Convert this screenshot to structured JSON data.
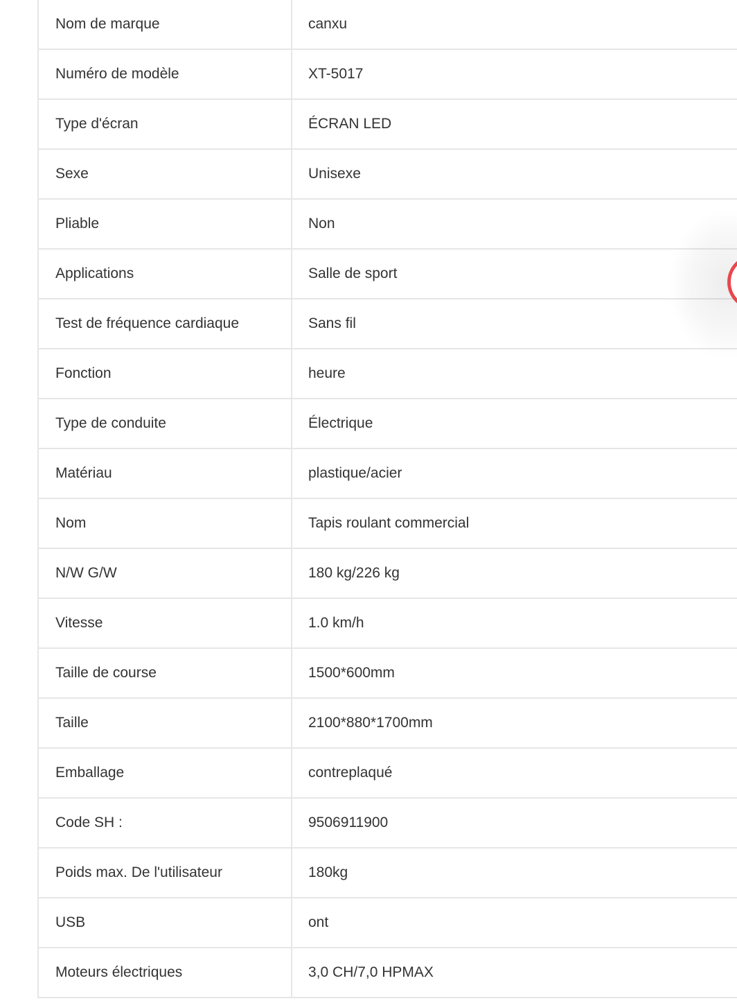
{
  "specs": {
    "rows": [
      {
        "label": "Nom de marque",
        "value": "canxu"
      },
      {
        "label": "Numéro de modèle",
        "value": "XT-5017"
      },
      {
        "label": "Type d'écran",
        "value": "ÉCRAN LED"
      },
      {
        "label": "Sexe",
        "value": "Unisexe"
      },
      {
        "label": "Pliable",
        "value": "Non"
      },
      {
        "label": "Applications",
        "value": "Salle de sport"
      },
      {
        "label": "Test de fréquence cardiaque",
        "value": "Sans fil"
      },
      {
        "label": "Fonction",
        "value": "heure"
      },
      {
        "label": "Type de conduite",
        "value": "Électrique"
      },
      {
        "label": "Matériau",
        "value": "plastique/acier"
      },
      {
        "label": "Nom",
        "value": "Tapis roulant commercial"
      },
      {
        "label": "N/W G/W",
        "value": "180 kg/226 kg"
      },
      {
        "label": "Vitesse",
        "value": "1.0 km/h"
      },
      {
        "label": "Taille de course",
        "value": "1500*600mm"
      },
      {
        "label": "Taille",
        "value": "2100*880*1700mm"
      },
      {
        "label": "Emballage",
        "value": "contreplaqué"
      },
      {
        "label": "Code SH :",
        "value": "9506911900"
      },
      {
        "label": "Poids max. De l'utilisateur",
        "value": "180kg"
      },
      {
        "label": "USB",
        "value": "ont"
      },
      {
        "label": "Moteurs électriques",
        "value": "3,0 CH/7,0 HPMAX"
      }
    ]
  },
  "colors": {
    "text": "#333333",
    "border": "#e6e6e6",
    "floating_button_ring": "#e8474c"
  }
}
